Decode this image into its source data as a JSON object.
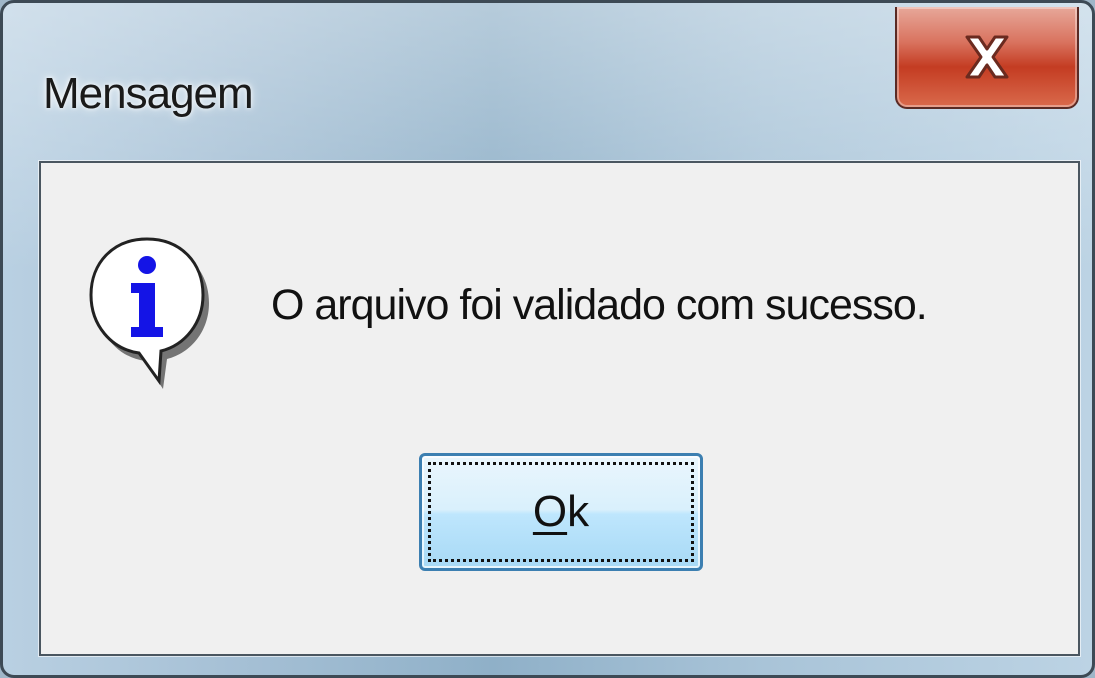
{
  "window": {
    "title": "Mensagem"
  },
  "title_bar": {
    "close_icon": "close-icon"
  },
  "dialog": {
    "icon": "information-icon",
    "message": "O arquivo foi validado com sucesso.",
    "ok_button": {
      "mnemonic": "O",
      "rest": "k"
    }
  },
  "colors": {
    "close_button": "#c43c22",
    "info_icon_letter": "#1414e6",
    "dialog_background": "#f0f0f0",
    "button_border": "#3c7fb1"
  }
}
